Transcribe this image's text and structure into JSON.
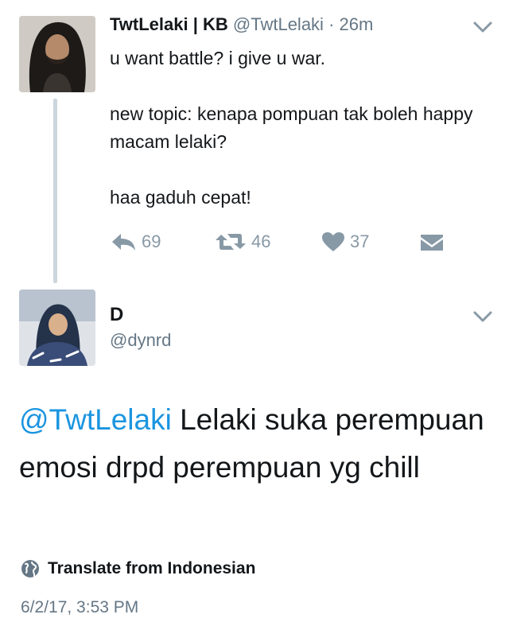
{
  "tweet": {
    "author_name": "TwtLelaki | KB",
    "handle": "@TwtLelaki",
    "separator": "·",
    "time_ago": "26m",
    "lines": [
      "u want battle? i give u war.",
      "new topic: kenapa pompuan tak boleh happy macam lelaki?",
      "haa gaduh cepat!"
    ],
    "actions": {
      "reply_count": "69",
      "retweet_count": "46",
      "like_count": "37"
    }
  },
  "reply": {
    "author_name": "D",
    "handle": "@dynrd",
    "mention": "@TwtLelaki",
    "text": " Lelaki suka perempuan emosi drpd perempuan yg chill",
    "translate_label": "Translate from Indonesian",
    "timestamp": "6/2/17, 3:53 PM"
  },
  "colors": {
    "link_blue": "#1b95e0",
    "muted_gray": "#657786",
    "icon_gray": "#8899a6",
    "thread_line": "#ccd6dd"
  }
}
